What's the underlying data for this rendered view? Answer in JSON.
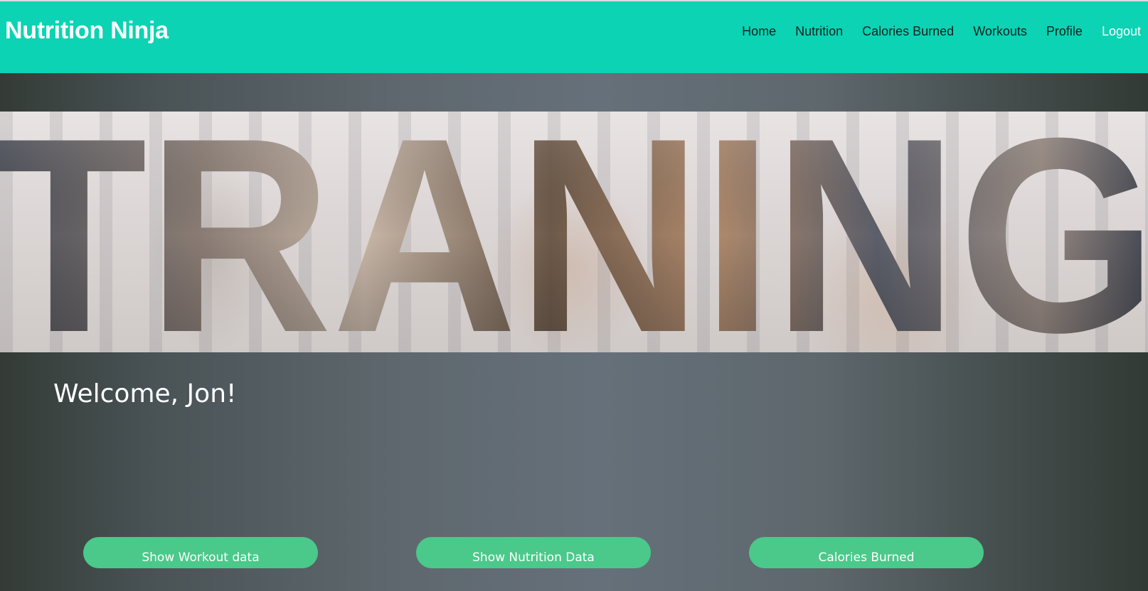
{
  "brand": "Nutrition Ninja",
  "nav": {
    "home": "Home",
    "nutrition": "Nutrition",
    "calories_burned": "Calories Burned",
    "workouts": "Workouts",
    "profile": "Profile",
    "logout": "Logout"
  },
  "banner": {
    "text": "TRANING"
  },
  "welcome": "Welcome, Jon!",
  "actions": {
    "workout": "Show Workout data",
    "nutrition": "Show Nutrition Data",
    "calories": "Calories Burned"
  },
  "colors": {
    "navbar": "#0bd3b4",
    "button": "#4ac98a"
  }
}
